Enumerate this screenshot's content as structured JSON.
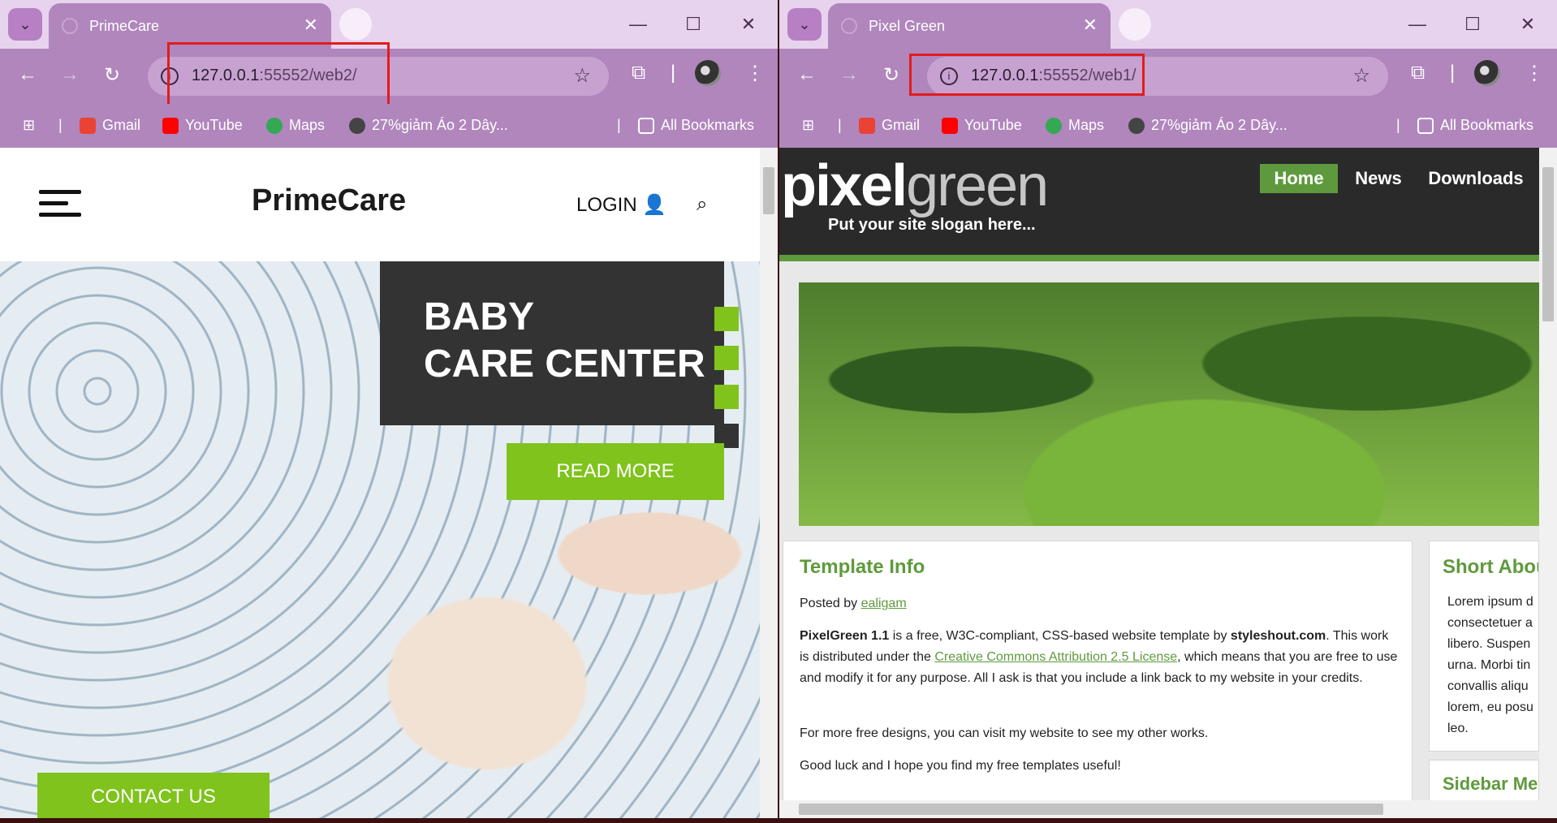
{
  "left": {
    "tab_title": "PrimeCare",
    "url_host": "127.0.0.1",
    "url_rest": ":55552/web2/",
    "bookmarks": {
      "gmail": "Gmail",
      "youtube": "YouTube",
      "maps": "Maps",
      "sale": "27%giảm Áo 2 Dây...",
      "all": "All Bookmarks"
    },
    "site": {
      "logo": "PrimeCare",
      "login": "LOGIN",
      "hero_line1": "BABY",
      "hero_line2": "CARE CENTER",
      "read_more": "READ MORE",
      "contact": "CONTACT US"
    }
  },
  "right": {
    "tab_title": "Pixel Green",
    "url_host": "127.0.0.1",
    "url_rest": ":55552/web1/",
    "bookmarks": {
      "gmail": "Gmail",
      "youtube": "YouTube",
      "maps": "Maps",
      "sale": "27%giảm Áo 2 Dây...",
      "all": "All Bookmarks"
    },
    "site": {
      "logo_a": "pixel",
      "logo_b": "green",
      "slogan": "Put your site slogan here...",
      "nav": [
        "Home",
        "News",
        "Downloads"
      ],
      "post_title": "Template Info",
      "posted_by_prefix": "Posted by ",
      "posted_by_user": "ealigam",
      "p1_strong1": "PixelGreen 1.1",
      "p1_a": " is a free, W3C-compliant, CSS-based website template by ",
      "p1_strong2": "styleshout.com",
      "p1_b": ". This work is distributed under the ",
      "p1_link": "Creative Commons Attribution 2.5 License",
      "p1_c": ", which means that you are free to use and modify it for any purpose. All I ask is that you include a link back to my website in your credits.",
      "p2": "For more free designs, you can visit my website to see my other works.",
      "p3": "Good luck and I hope you find my free templates useful!",
      "side_title": "Short About",
      "side_text": "Lorem ipsum d consectetuer a libero. Suspen urna. Morbi tin convallis aliqu lorem, eu posu leo.",
      "side2_title": "Sidebar Me"
    }
  },
  "colors": {
    "accent_green": "#7fc31c",
    "pg_green": "#5e9a3d",
    "chrome": "#b086bd"
  }
}
